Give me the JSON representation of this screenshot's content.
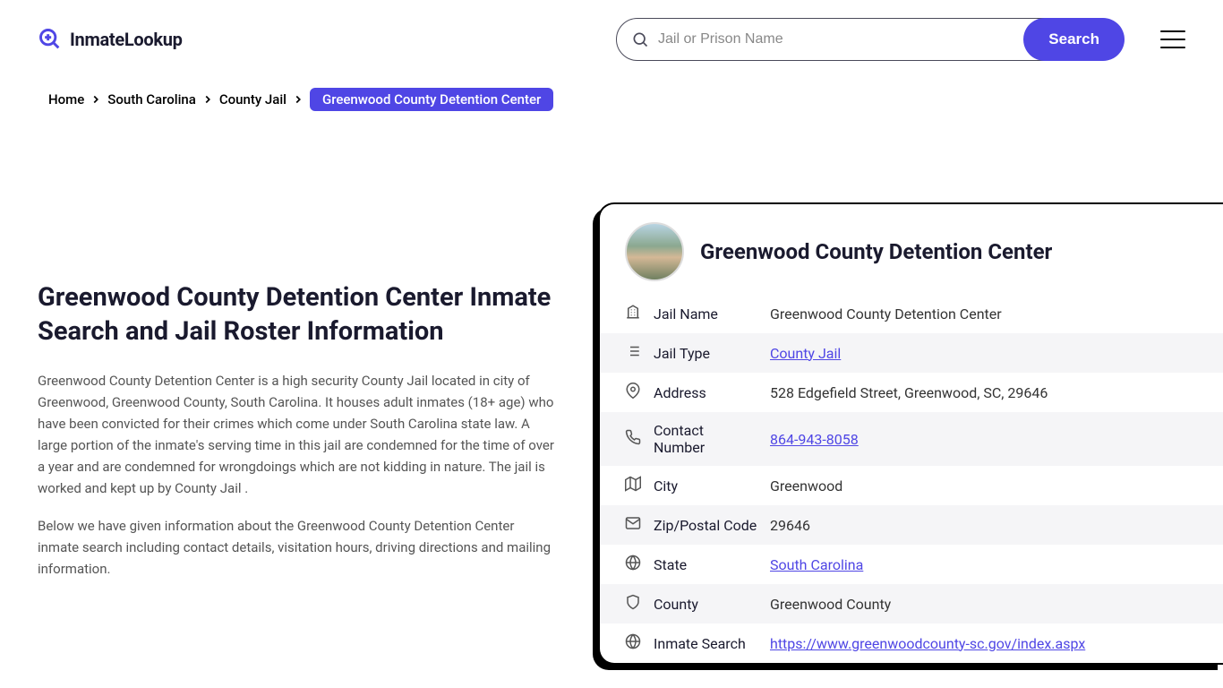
{
  "logo": {
    "text": "InmateLookup"
  },
  "search": {
    "placeholder": "Jail or Prison Name",
    "button": "Search"
  },
  "breadcrumb": {
    "items": [
      "Home",
      "South Carolina",
      "County Jail"
    ],
    "current": "Greenwood County Detention Center"
  },
  "content": {
    "heading": "Greenwood County Detention Center Inmate Search and Jail Roster Information",
    "para1": "Greenwood County Detention Center is a high security County Jail located in city of Greenwood, Greenwood County, South Carolina. It houses adult inmates (18+ age) who have been convicted for their crimes which come under South Carolina state law. A large portion of the inmate's serving time in this jail are condemned for the time of over a year and are condemned for wrongdoings which are not kidding in nature. The jail is worked and kept up by County Jail .",
    "para2": "Below we have given information about the Greenwood County Detention Center inmate search including contact details, visitation hours, driving directions and mailing information."
  },
  "card": {
    "title": "Greenwood County Detention Center",
    "rows": [
      {
        "icon": "building",
        "label": "Jail Name",
        "value": "Greenwood County Detention Center",
        "link": false
      },
      {
        "icon": "list",
        "label": "Jail Type",
        "value": "County Jail",
        "link": true
      },
      {
        "icon": "pin",
        "label": "Address",
        "value": "528 Edgefield Street, Greenwood, SC, 29646",
        "link": false
      },
      {
        "icon": "phone",
        "label": "Contact Number",
        "value": "864-943-8058",
        "link": true
      },
      {
        "icon": "map",
        "label": "City",
        "value": "Greenwood",
        "link": false
      },
      {
        "icon": "mail",
        "label": "Zip/Postal Code",
        "value": "29646",
        "link": false
      },
      {
        "icon": "globe",
        "label": "State",
        "value": "South Carolina",
        "link": true
      },
      {
        "icon": "shield",
        "label": "County",
        "value": "Greenwood County",
        "link": false
      },
      {
        "icon": "web",
        "label": "Inmate Search",
        "value": "https://www.greenwoodcounty-sc.gov/index.aspx",
        "link": true
      }
    ]
  }
}
